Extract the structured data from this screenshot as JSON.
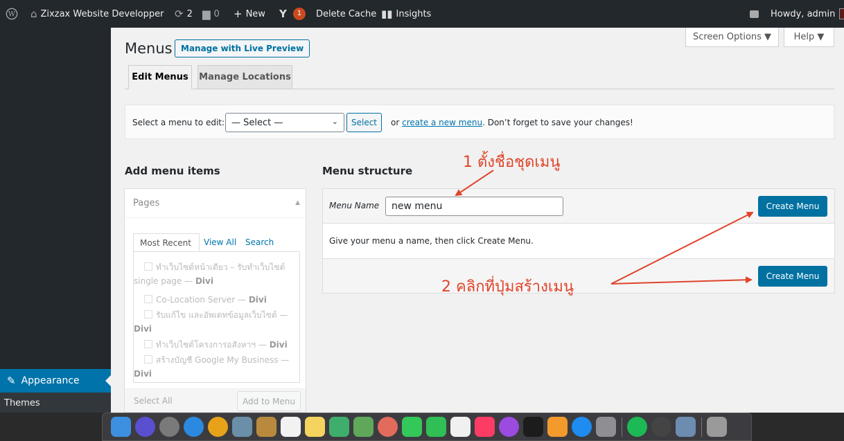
{
  "admin_bar": {
    "wp_logo_icon": "wordpress-logo-icon",
    "site_icon": "home-icon",
    "site_name": "Zixzax Website Developper",
    "updates_icon": "refresh-icon",
    "updates_count": "2",
    "comments_icon": "speech-bubble-icon",
    "comments_count": "0",
    "new_icon": "plus-icon",
    "new_label": "New",
    "yoast_icon": "yoast-icon",
    "yoast_badge": "1",
    "delete_cache": "Delete Cache",
    "insights_icon": "bar-chart-icon",
    "insights": "Insights",
    "howdy": "Howdy, admin"
  },
  "screen_meta": {
    "screen_options": "Screen Options ▼",
    "help": "Help ▼"
  },
  "sidebar": {
    "active_item": "Appearance",
    "active_icon": "paintbrush-icon",
    "submenu_item": "Themes"
  },
  "heading": {
    "title": "Menus",
    "live_preview": "Manage with Live Preview"
  },
  "tabs": [
    {
      "label": "Edit Menus",
      "active": true
    },
    {
      "label": "Manage Locations",
      "active": false
    }
  ],
  "manage_bar": {
    "label": "Select a menu to edit:",
    "select_value": "— Select —",
    "select_button": "Select",
    "hint_prefix": "or",
    "create_link": "create a new menu",
    "hint_suffix": ". Don’t forget to save your changes!"
  },
  "add_items": {
    "title": "Add menu items",
    "panel_title": "Pages",
    "subtabs": [
      "Most Recent",
      "View All",
      "Search"
    ],
    "pages": [
      {
        "line1": "ทำเว็บไซต์หน้าเดียว – รับทำเว็บไซต์",
        "line2": "single page — ",
        "tag": "Divi"
      },
      {
        "line1": "Co-Location Server — ",
        "tag": "Divi"
      },
      {
        "line1": "รับแก้ไข และอัพเดทข้อมูลเว็บไซต์ —",
        "line2": "",
        "tag": "Divi"
      },
      {
        "line1": "ทำเว็บไซต์โครงการอสังหาฯ — ",
        "tag": "Divi"
      },
      {
        "line1": "สร้างบัญชี Google My Business —",
        "line2": "",
        "tag": "Divi"
      }
    ],
    "select_all": "Select All",
    "add_to_menu": "Add to Menu"
  },
  "structure": {
    "title": "Menu structure",
    "menu_name_label": "Menu Name",
    "menu_name_value": "new menu",
    "create_button": "Create Menu",
    "instructions": "Give your menu a name, then click Create Menu."
  },
  "annotations": {
    "step1": "1 ตั้งชื่อชุดเมนู",
    "step2": "2 คลิกที่ปุ่มสร้างเมนู",
    "color": "#e0442a"
  },
  "dock": {
    "apps": [
      {
        "name": "finder-icon",
        "color": "#3d8fe0"
      },
      {
        "name": "siri-icon",
        "color": "#5a4fcf"
      },
      {
        "name": "launchpad-icon",
        "color": "#7a7a7a"
      },
      {
        "name": "safari-icon",
        "color": "#2b8ae0"
      },
      {
        "name": "chrome-icon",
        "color": "#e8a21a"
      },
      {
        "name": "preview-icon",
        "color": "#6b8fa8"
      },
      {
        "name": "notebook-icon",
        "color": "#b98a3e"
      },
      {
        "name": "calendar-icon",
        "color": "#f2f2f2"
      },
      {
        "name": "notes-icon",
        "color": "#f4d35e"
      },
      {
        "name": "atom-icon",
        "color": "#3fae6d"
      },
      {
        "name": "maps-icon",
        "color": "#5fa85a"
      },
      {
        "name": "photos-icon",
        "color": "#e26b5b"
      },
      {
        "name": "messages-icon",
        "color": "#34c759"
      },
      {
        "name": "facetime-icon",
        "color": "#2fbf55"
      },
      {
        "name": "reminders-icon",
        "color": "#f0f0f0"
      },
      {
        "name": "music-icon",
        "color": "#fc3c64"
      },
      {
        "name": "podcasts-icon",
        "color": "#9b4be0"
      },
      {
        "name": "appletv-icon",
        "color": "#1c1c1c"
      },
      {
        "name": "books-icon",
        "color": "#f39a2c"
      },
      {
        "name": "appstore-icon",
        "color": "#1e8cf0"
      },
      {
        "name": "system-preferences-icon",
        "color": "#8e8e93"
      },
      {
        "name": "spotify-icon",
        "color": "#1db954"
      },
      {
        "name": "openai-icon",
        "color": "#444"
      },
      {
        "name": "image-capture-icon",
        "color": "#6c8cb0"
      },
      {
        "name": "trash-icon",
        "color": "#9a9a9a"
      }
    ]
  }
}
